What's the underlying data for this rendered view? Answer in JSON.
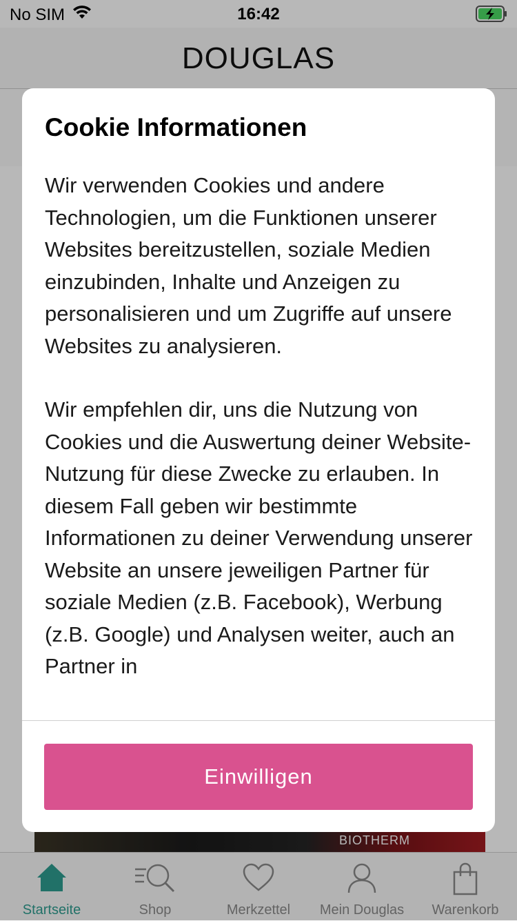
{
  "status_bar": {
    "carrier": "No SIM",
    "time": "16:42",
    "icons": [
      "wifi-icon",
      "battery-charging-icon"
    ]
  },
  "header": {
    "logo": "DOUGLAS"
  },
  "banner": {
    "text": "BIOTHERM"
  },
  "modal": {
    "title": "Cookie Informationen",
    "paragraphs": [
      "Wir verwenden Cookies und andere Technologien, um die Funktionen unserer Websites bereitzustellen, soziale Medien einzubinden, Inhalte und Anzeigen zu personalisieren und um Zugriffe auf unsere Websites zu analysieren.",
      "Wir empfehlen dir, uns die Nutzung von Cookies und die Auswertung deiner Website-Nutzung für diese Zwecke zu erlauben. In diesem Fall geben wir bestimmte Informationen zu deiner Verwendung unserer Website an unsere jeweiligen Partner für soziale Medien (z.B. Facebook), Werbung (z.B. Google) und Analysen weiter, auch an Partner in"
    ],
    "accept_label": "Einwilligen",
    "accent_color": "#d9528f"
  },
  "tab_bar": {
    "active_color": "#2f9d90",
    "items": [
      {
        "label": "Startseite",
        "icon": "home-icon",
        "active": true
      },
      {
        "label": "Shop",
        "icon": "shop-search-icon",
        "active": false
      },
      {
        "label": "Merkzettel",
        "icon": "heart-icon",
        "active": false
      },
      {
        "label": "Mein Douglas",
        "icon": "user-icon",
        "active": false
      },
      {
        "label": "Warenkorb",
        "icon": "shopping-bag-icon",
        "active": false
      }
    ]
  }
}
